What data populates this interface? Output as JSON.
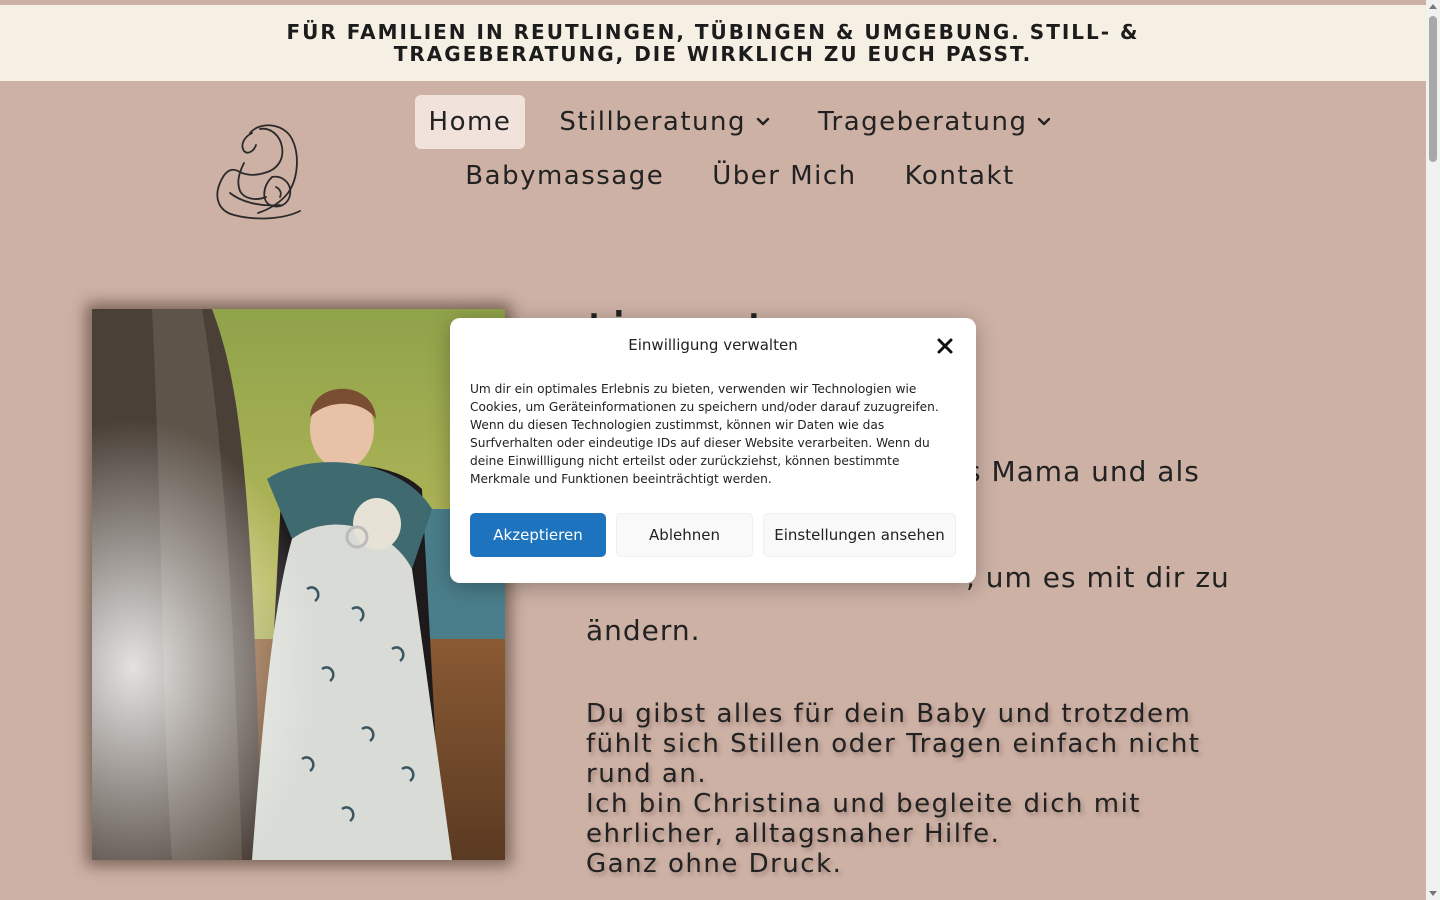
{
  "announcement": {
    "text": "FÜR FAMILIEN IN REUTLINGEN, TÜBINGEN & UMGEBUNG. STILL- & TRAGEBERATUNG, DIE WIRKLICH ZU EUCH PASST."
  },
  "header": {
    "logo_icon": "mother-nursing-baby-line-art",
    "nav_row1": [
      {
        "label": "Home",
        "active": true
      },
      {
        "label": "Stillberatung",
        "dropdown": true
      },
      {
        "label": "Trageberatung",
        "dropdown": true
      }
    ],
    "nav_row2": [
      {
        "label": "Babymassage"
      },
      {
        "label": "Über Mich"
      },
      {
        "label": "Kontakt"
      }
    ]
  },
  "hero": {
    "heading_visible": "timmt",
    "para1_line1_visible": "s Mama und als",
    "para1_line2_visible": ", um es mit dir zu",
    "para1_line3": "ändern.",
    "para2_lines": [
      "Du gibst alles für dein Baby und trotzdem",
      "fühlt sich Stillen oder Tragen einfach nicht",
      "rund an.",
      "Ich bin Christina und begleite dich mit",
      "ehrlicher, alltagsnaher Hilfe.",
      "Ganz ohne Druck."
    ]
  },
  "consent": {
    "title": "Einwilligung verwalten",
    "body": "Um dir ein optimales Erlebnis zu bieten, verwenden wir Technologien wie Cookies, um Geräteinformationen zu speichern und/oder darauf zuzugreifen. Wenn du diesen Technologien zustimmst, können wir Daten wie das Surfverhalten oder eindeutige IDs auf dieser Website verarbeiten. Wenn du deine Einwillligung nicht erteilst oder zurückziehst, können bestimmte Merkmale und Funktionen beeinträchtigt werden.",
    "accept_label": "Akzeptieren",
    "deny_label": "Ablehnen",
    "settings_label": "Einstellungen ansehen"
  },
  "colors": {
    "background": "#cdb1a5",
    "announcement_bg": "#f6efe4",
    "nav_active_bg": "#f2e2dc",
    "accept_button": "#1e73be"
  }
}
